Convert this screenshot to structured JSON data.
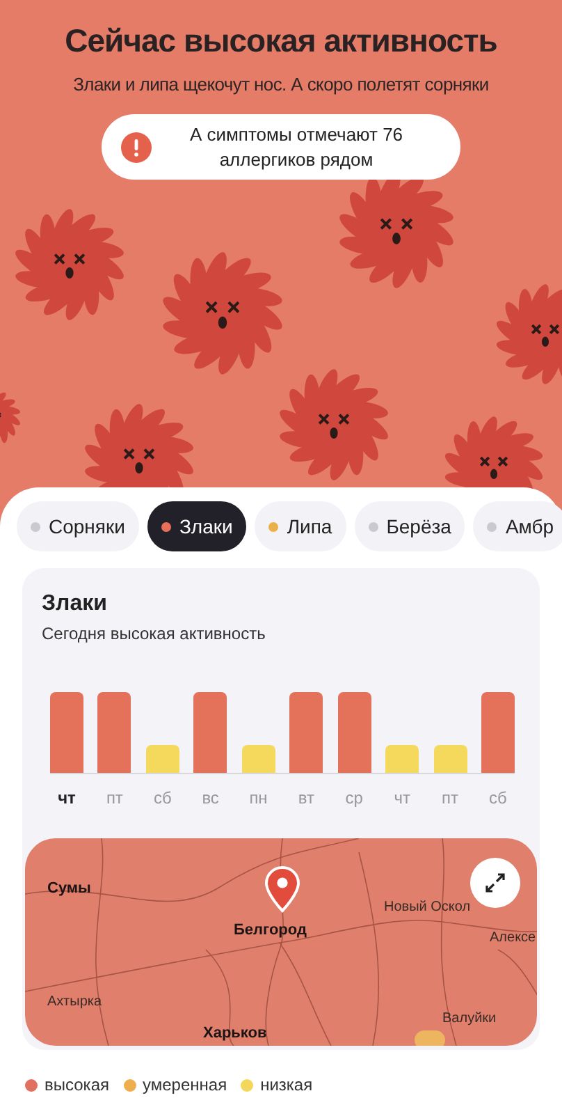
{
  "header": {
    "title": "Сейчас высокая активность",
    "subtitle": "Злаки и липа щекочут нос. А скоро полетят сорняки",
    "notice": "А симптомы отмечают 76 аллергиков рядом"
  },
  "tabs": [
    {
      "label": "Сорняки",
      "selected": false,
      "color": "#c9c9cf"
    },
    {
      "label": "Злаки",
      "selected": true,
      "color": "#e8705a"
    },
    {
      "label": "Липа",
      "selected": false,
      "color": "#eab04a"
    },
    {
      "label": "Берёза",
      "selected": false,
      "color": "#c9c9cf"
    },
    {
      "label": "Амбр",
      "selected": false,
      "color": "#c9c9cf"
    }
  ],
  "card": {
    "title": "Злаки",
    "subtitle": "Сегодня высокая активность",
    "days": [
      {
        "label": "чт",
        "today": true,
        "kind": "high",
        "color": "#e4715a"
      },
      {
        "label": "пт",
        "today": false,
        "kind": "high",
        "color": "#e4715a"
      },
      {
        "label": "сб",
        "today": false,
        "kind": "low",
        "color": "#f4d95c"
      },
      {
        "label": "вс",
        "today": false,
        "kind": "high",
        "color": "#e4715a"
      },
      {
        "label": "пн",
        "today": false,
        "kind": "low",
        "color": "#f4d95c"
      },
      {
        "label": "вт",
        "today": false,
        "kind": "high",
        "color": "#e4715a"
      },
      {
        "label": "ср",
        "today": false,
        "kind": "high",
        "color": "#e4715a"
      },
      {
        "label": "чт",
        "today": false,
        "kind": "low",
        "color": "#f4d95c"
      },
      {
        "label": "пт",
        "today": false,
        "kind": "low",
        "color": "#f4d95c"
      },
      {
        "label": "сб",
        "today": false,
        "kind": "high",
        "color": "#e4715a"
      }
    ],
    "map": {
      "places": [
        {
          "label": "Сумы",
          "major": true
        },
        {
          "label": "Белгород",
          "major": true
        },
        {
          "label": "Новый Оскол",
          "major": false
        },
        {
          "label": "Алексе",
          "major": false
        },
        {
          "label": "Ахтырка",
          "major": false
        },
        {
          "label": "Валуйки",
          "major": false
        },
        {
          "label": "Харьков",
          "major": true
        }
      ]
    }
  },
  "legend": [
    {
      "label": "высокая",
      "color": "#e07060"
    },
    {
      "label": "умеренная",
      "color": "#eeae4e"
    },
    {
      "label": "низкая",
      "color": "#f2d75a"
    }
  ]
}
